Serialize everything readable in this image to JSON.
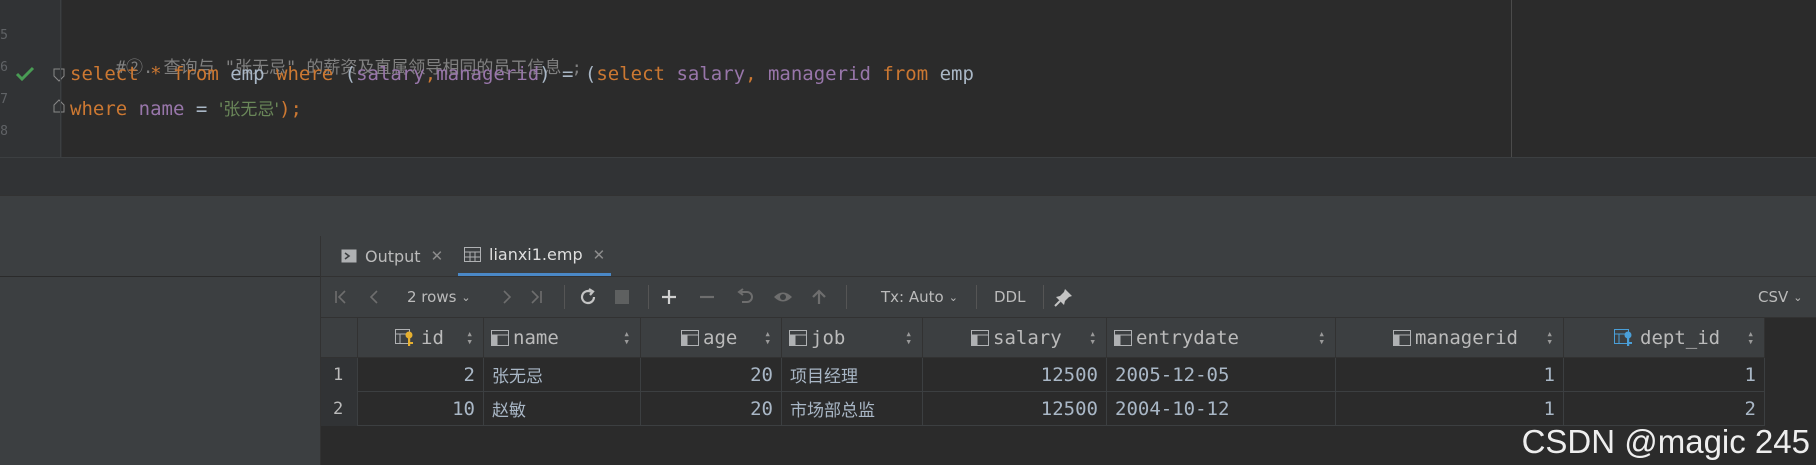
{
  "editor": {
    "line_numbers": [
      "5",
      "6",
      "7",
      "8"
    ],
    "comment": "#②. 查询与 \"张无忌\" 的薪资及直属领导相同的员工信息 ;",
    "line2": {
      "t1": "select",
      "t2": "*",
      "t3": "from",
      "t4": "emp",
      "t5": "where",
      "t6": "(",
      "t7": "salary",
      "t8": ",",
      "t9": "managerid",
      "t10": ") = (",
      "t11": "select",
      "t12": "salary",
      "t13": ", ",
      "t14": "managerid",
      "t15": "from",
      "t16": "emp"
    },
    "line3": {
      "t1": "where",
      "t2": "name",
      "t3": " = ",
      "t4": "'张无忌'",
      "t5": ");"
    }
  },
  "tabs": [
    {
      "label": "Output",
      "icon": "console-icon"
    },
    {
      "label": "lianxi1.emp",
      "icon": "table-icon",
      "active": true
    }
  ],
  "toolbar": {
    "rows_label": "2 rows",
    "tx_label": "Tx: Auto",
    "ddl_label": "DDL",
    "export_label": "CSV"
  },
  "grid": {
    "columns": [
      {
        "name": "id",
        "icon": "primary-key-icon"
      },
      {
        "name": "name",
        "icon": "column-icon"
      },
      {
        "name": "age",
        "icon": "column-icon"
      },
      {
        "name": "job",
        "icon": "column-icon"
      },
      {
        "name": "salary",
        "icon": "column-icon"
      },
      {
        "name": "entrydate",
        "icon": "column-icon"
      },
      {
        "name": "managerid",
        "icon": "column-icon"
      },
      {
        "name": "dept_id",
        "icon": "foreign-key-icon"
      }
    ],
    "rows": [
      {
        "num": "1",
        "id": "2",
        "name": "张无忌",
        "age": "20",
        "job": "项目经理",
        "salary": "12500",
        "entrydate": "2005-12-05",
        "managerid": "1",
        "dept_id": "1"
      },
      {
        "num": "2",
        "id": "10",
        "name": "赵敏",
        "age": "20",
        "job": "市场部总监",
        "salary": "12500",
        "entrydate": "2004-10-12",
        "managerid": "1",
        "dept_id": "2"
      }
    ]
  },
  "watermark": "CSDN @magic 245",
  "colors": {
    "keyword": "#cc7832",
    "column": "#9876aa",
    "string": "#6a8759",
    "check": "#499c54",
    "accent": "#4a88c7"
  }
}
